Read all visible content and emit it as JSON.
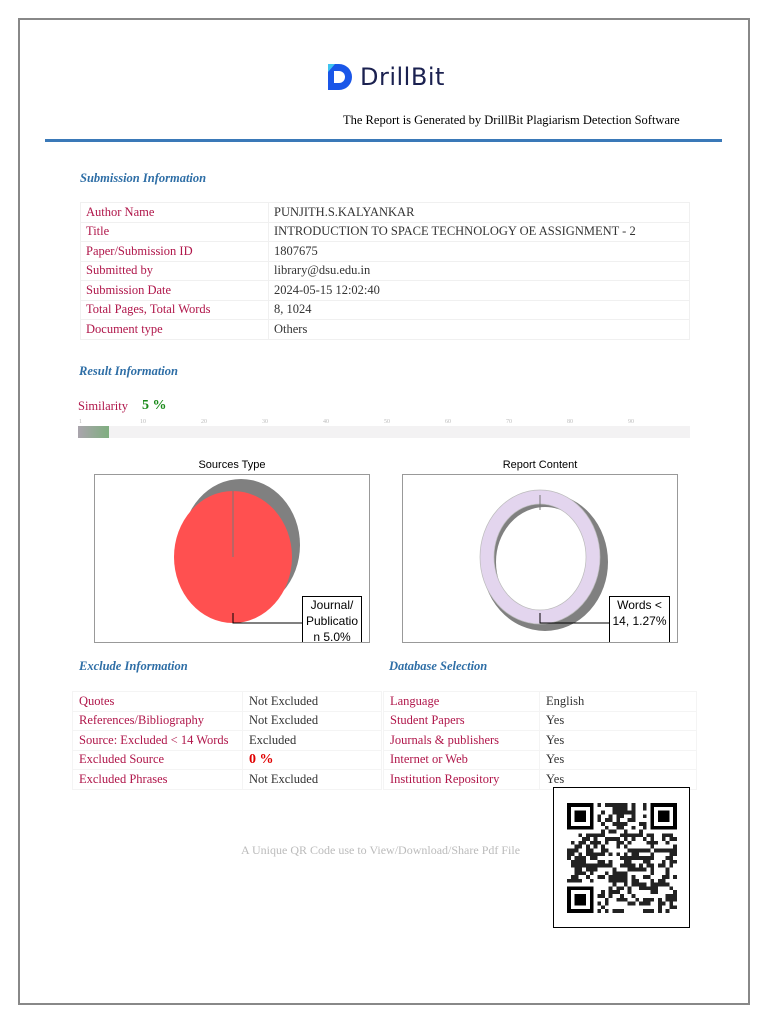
{
  "header": {
    "brand": "DrillBit",
    "generated_by": "The Report is Generated by DrillBit Plagiarism Detection Software"
  },
  "submission": {
    "heading": "Submission Information",
    "rows": [
      {
        "label": "Author Name",
        "value": "PUNJITH.S.KALYANKAR"
      },
      {
        "label": "Title",
        "value": "INTRODUCTION TO SPACE TECHNOLOGY OE ASSIGNMENT - 2"
      },
      {
        "label": "Paper/Submission ID",
        "value": "1807675"
      },
      {
        "label": "Submitted by",
        "value": "library@dsu.edu.in"
      },
      {
        "label": "Submission Date",
        "value": "2024-05-15 12:02:40"
      },
      {
        "label": "Total Pages, Total Words",
        "value": "8, 1024"
      },
      {
        "label": "Document type",
        "value": "Others"
      }
    ]
  },
  "result": {
    "heading": "Result Information",
    "similarity_label": "Similarity",
    "similarity_value": "5 %",
    "similarity_percent": 5,
    "ticks": [
      "1",
      "10",
      "20",
      "30",
      "40",
      "50",
      "60",
      "70",
      "80",
      "90"
    ]
  },
  "charts": {
    "sources": {
      "title": "Sources Type",
      "callout": "Journal/ Publicatio n 5.0%",
      "color": "#ff5050",
      "slices": [
        {
          "name": "Journal/Publication",
          "value": 5.0
        }
      ]
    },
    "content": {
      "title": "Report Content",
      "callout": "Words < 14, 1.27%",
      "color": "#e3d5ee",
      "slices": [
        {
          "name": "Words < 14",
          "value": 1.27
        }
      ]
    }
  },
  "exclude": {
    "heading": "Exclude Information",
    "rows": [
      {
        "label": "Quotes",
        "value": "Not Excluded"
      },
      {
        "label": "References/Bibliography",
        "value": "Not Excluded"
      },
      {
        "label": "Source: Excluded < 14 Words",
        "value": "Excluded"
      },
      {
        "label": "Excluded Source",
        "value": "0 %"
      },
      {
        "label": "Excluded Phrases",
        "value": "Not Excluded"
      }
    ]
  },
  "database": {
    "heading": "Database Selection",
    "rows": [
      {
        "label": "Language",
        "value": "English"
      },
      {
        "label": "Student Papers",
        "value": "Yes"
      },
      {
        "label": "Journals & publishers",
        "value": "Yes"
      },
      {
        "label": "Internet or Web",
        "value": "Yes"
      },
      {
        "label": "Institution Repository",
        "value": "Yes"
      }
    ]
  },
  "qr": {
    "caption": "A Unique QR Code use to View/Download/Share Pdf File"
  }
}
